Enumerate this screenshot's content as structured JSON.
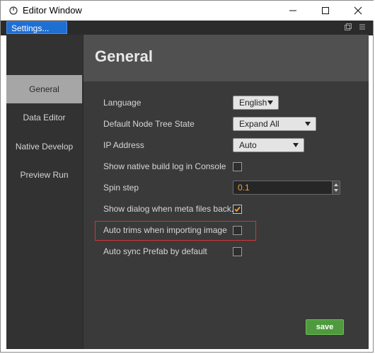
{
  "window": {
    "title": "Editor Window",
    "controls": {
      "minimize_icon": "minimize-icon",
      "maximize_icon": "maximize-icon",
      "close_icon": "close-icon"
    }
  },
  "tabs": [
    {
      "label": "Settings...",
      "active": true
    }
  ],
  "sidebar": {
    "items": [
      {
        "label": "General",
        "active": true
      },
      {
        "label": "Data Editor",
        "active": false
      },
      {
        "label": "Native Develop",
        "active": false
      },
      {
        "label": "Preview Run",
        "active": false
      }
    ]
  },
  "main": {
    "title": "General",
    "settings": {
      "language": {
        "label": "Language",
        "value": "English"
      },
      "default_node_tree_state": {
        "label": "Default Node Tree State",
        "value": "Expand All"
      },
      "ip_address": {
        "label": "IP Address",
        "value": "Auto"
      },
      "show_native_build_log": {
        "label": "Show native build log in Console",
        "checked": false
      },
      "spin_step": {
        "label": "Spin step",
        "value": "0.1"
      },
      "show_dialog_meta": {
        "label": "Show dialog when meta files back...",
        "checked": true
      },
      "auto_trims": {
        "label": "Auto trims when importing image",
        "checked": false
      },
      "auto_sync_prefab": {
        "label": "Auto sync Prefab by default",
        "checked": false
      }
    },
    "save_label": "save"
  },
  "colors": {
    "accent_tab": "#1f6fd3",
    "save_button": "#4f9a3e",
    "highlight_border": "#d0373a",
    "check_mark": "#f2a33a"
  }
}
